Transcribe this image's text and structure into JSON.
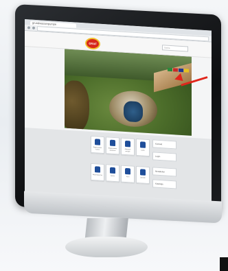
{
  "browser": {
    "tab_title": "grundwasserpumpe",
    "url": "",
    "search_placeholder": "Suche"
  },
  "site": {
    "logo_text": "GRAF",
    "hero_caption": "",
    "tiles_row1": [
      {
        "label": "Regenwasser nutzen",
        "icon": "tank-icon"
      },
      {
        "label": "Regenwasser versickern",
        "icon": "rain-icon"
      },
      {
        "label": "Abwasser reinigen",
        "icon": "treatment-icon"
      },
      {
        "label": "Carbo",
        "icon": "chair-icon"
      }
    ],
    "tiles_row2": [
      {
        "label": "Wasserspeicher",
        "icon": "tank-icon"
      },
      {
        "label": "Garten",
        "icon": "garden-icon"
      },
      {
        "label": "Teich",
        "icon": "pond-icon"
      },
      {
        "label": "Zubehör",
        "icon": "xl-icon"
      }
    ],
    "side_buttons": [
      "Kontakt",
      "Login",
      "Newsletter",
      "Kataloge"
    ],
    "tile_icon_color": "#1f4e9a",
    "accent_color": "#d6281a"
  },
  "annotation": {
    "arrow_color": "#e0261c"
  }
}
